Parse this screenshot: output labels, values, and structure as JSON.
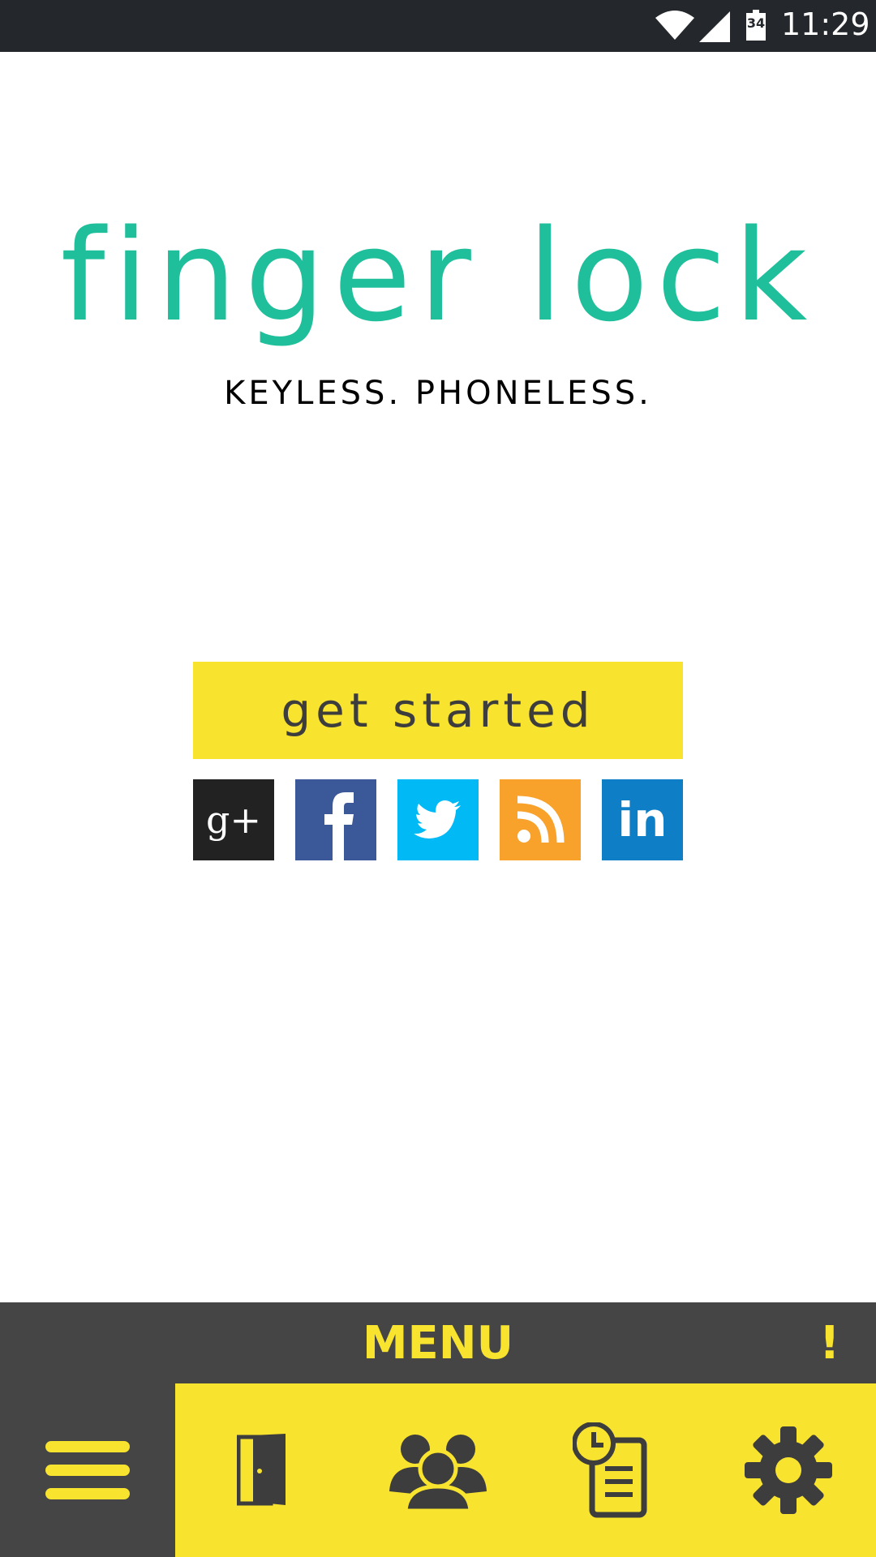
{
  "status_bar": {
    "battery_level": "34",
    "time": "11:29",
    "icons": [
      "wifi-icon",
      "cell-signal-icon",
      "battery-icon"
    ]
  },
  "brand": {
    "logo_text": "finger lock",
    "tagline": "KEYLESS. PHONELESS.",
    "logo_color": "#1fbf9b",
    "accent_color": "#f8e32f"
  },
  "actions": {
    "get_started_label": "get started"
  },
  "social": [
    {
      "name": "google-plus",
      "label": "g+",
      "color": "#222222"
    },
    {
      "name": "facebook",
      "label": "f",
      "color": "#3b5998"
    },
    {
      "name": "twitter",
      "label": "",
      "color": "#00b9f5"
    },
    {
      "name": "rss",
      "label": "",
      "color": "#f8a22c"
    },
    {
      "name": "linkedin",
      "label": "in",
      "color": "#0e7fc6"
    }
  ],
  "menu": {
    "title": "MENU",
    "alert": "!",
    "items": [
      "hamburger-icon",
      "door-icon",
      "users-icon",
      "history-log-icon",
      "settings-gear-icon"
    ]
  }
}
